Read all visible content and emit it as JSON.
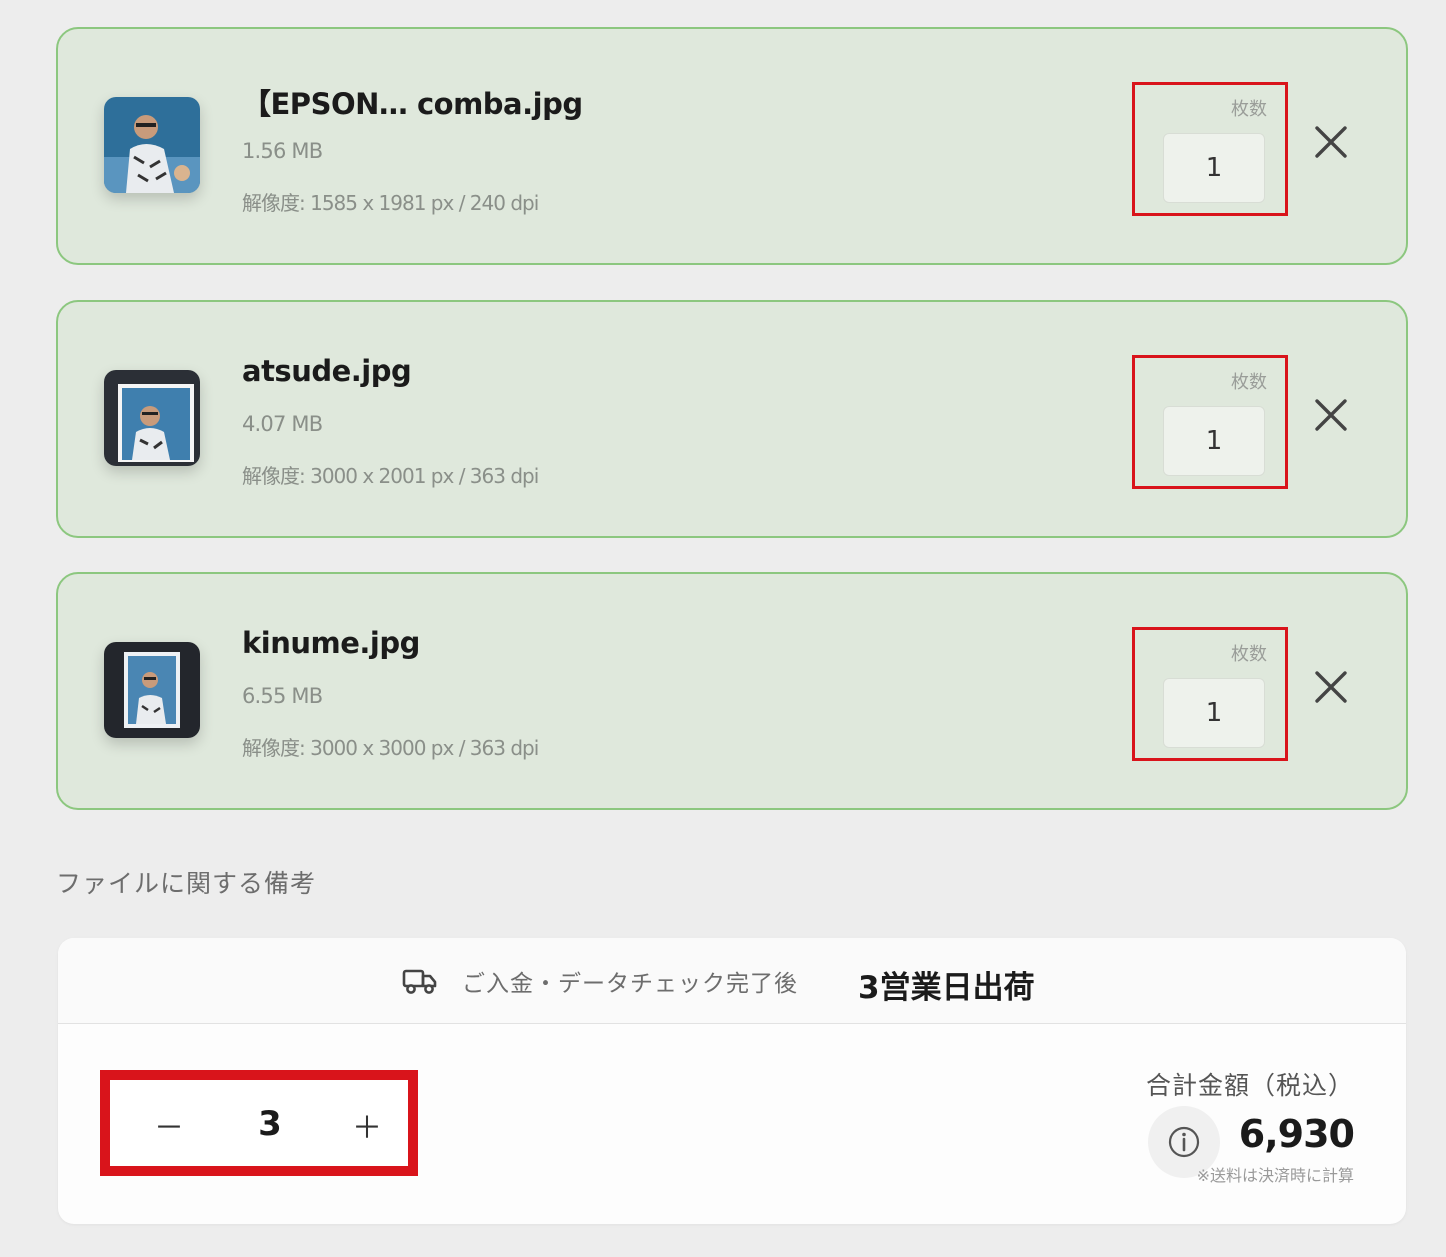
{
  "files": [
    {
      "name": "【EPSON… comba.jpg",
      "size": "1.56 MB",
      "resolution": "解像度: 1585 x 1981 px / 240 dpi",
      "quantity_label": "枚数",
      "quantity": "1"
    },
    {
      "name": "atsude.jpg",
      "size": "4.07 MB",
      "resolution": "解像度: 3000 x 2001 px / 363 dpi",
      "quantity_label": "枚数",
      "quantity": "1"
    },
    {
      "name": "kinume.jpg",
      "size": "6.55 MB",
      "resolution": "解像度: 3000 x 3000 px / 363 dpi",
      "quantity_label": "枚数",
      "quantity": "1"
    }
  ],
  "notes": {
    "label": "ファイルに関する備考"
  },
  "order": {
    "shipping_text": "ご入金・データチェック完了後",
    "shipping_emphasis": "3営業日出荷",
    "stepper": {
      "minus": "－",
      "value": "3",
      "plus": "＋"
    },
    "total_label": "合計金額（税込）",
    "total_amount": "6,930",
    "shipping_note": "※送料は決済時に計算"
  },
  "colors": {
    "card_bg": "#dfe8dc",
    "card_border": "#8cc77f",
    "highlight_red": "#d9141b",
    "page_bg": "#ededed"
  },
  "icons": {
    "remove": "close-icon",
    "shipping": "truck-icon",
    "info": "info-icon"
  }
}
